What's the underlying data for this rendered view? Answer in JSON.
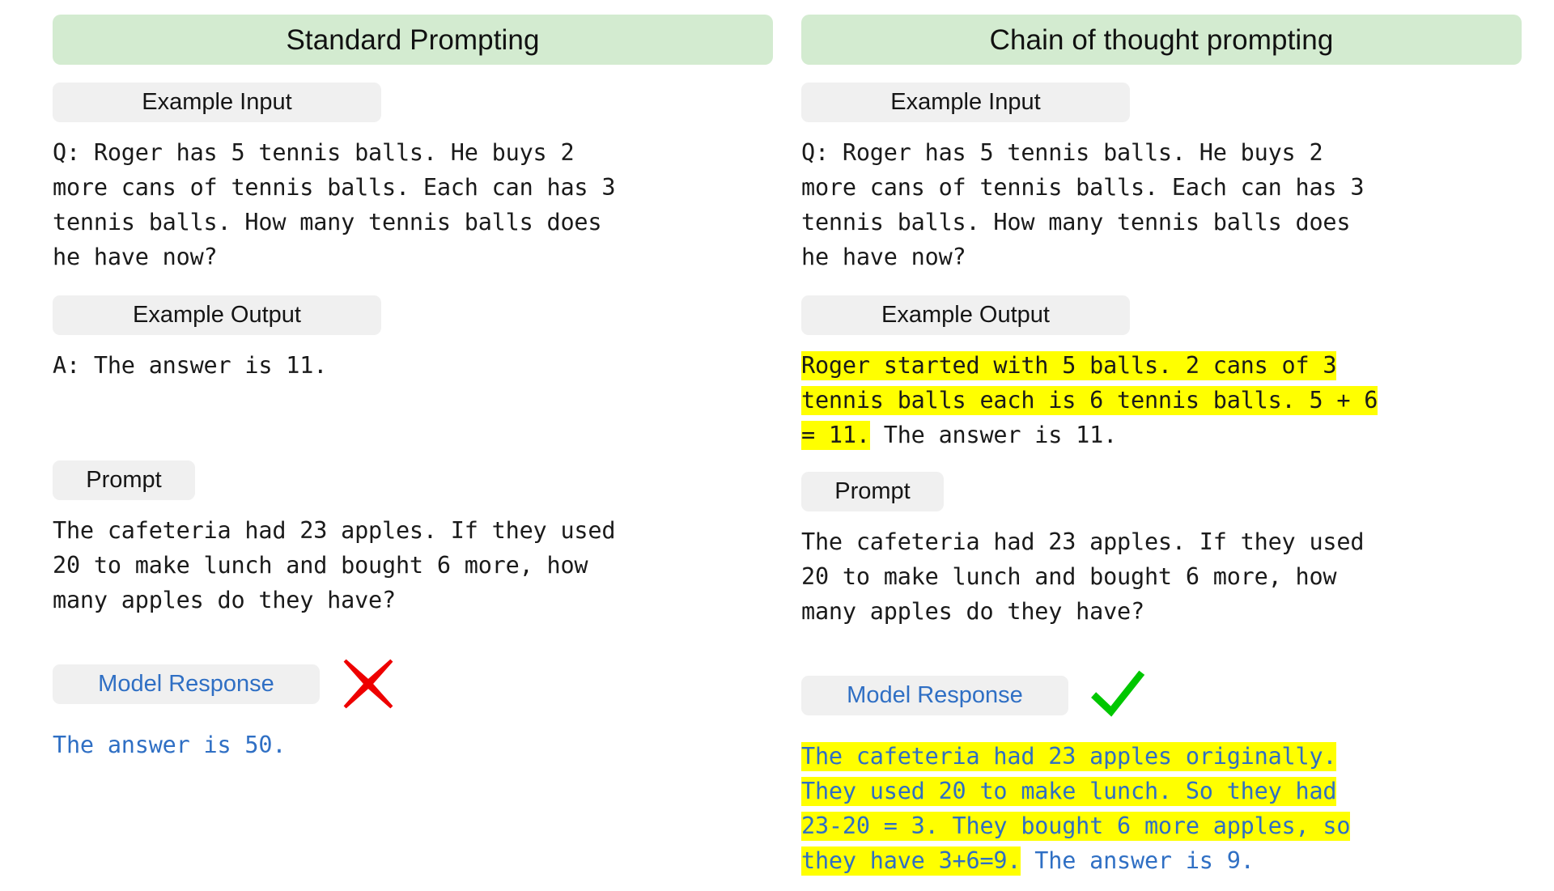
{
  "colors": {
    "header_bg": "#d3ebd0",
    "chip_bg": "#f0f0f0",
    "highlight": "#ffff00",
    "response_blue": "#2f6fc4",
    "cross_red": "#ee0000",
    "check_green": "#00c700",
    "body_text": "#1a1a1a"
  },
  "columns": [
    {
      "title": "Standard Prompting",
      "labels": {
        "example_input": "Example Input",
        "example_output": "Example Output",
        "prompt": "Prompt",
        "model_response": "Model Response"
      },
      "example_input": "Q: Roger has 5 tennis balls. He buys 2\nmore cans of tennis balls. Each can has 3\ntennis balls. How many tennis balls does\nhe have now?",
      "example_output": {
        "highlighted": "",
        "plain": "A: The answer is 11."
      },
      "prompt": "The cafeteria had 23 apples. If they used\n20 to make lunch and bought 6 more, how\nmany apples do they have?",
      "model_response": {
        "highlighted": "",
        "plain": "The answer is 50."
      },
      "verdict": "cross-icon",
      "verdict_label": "incorrect"
    },
    {
      "title": "Chain of thought prompting",
      "labels": {
        "example_input": "Example Input",
        "example_output": "Example Output",
        "prompt": "Prompt",
        "model_response": "Model Response"
      },
      "example_input": "Q: Roger has 5 tennis balls. He buys 2\nmore cans of tennis balls. Each can has 3\ntennis balls. How many tennis balls does\nhe have now?",
      "example_output": {
        "highlighted": "Roger started with 5 balls. 2 cans of 3\ntennis balls each is 6 tennis balls. 5 + 6\n= 11.",
        "plain": " The answer is 11."
      },
      "prompt": "The cafeteria had 23 apples. If they used\n20 to make lunch and bought 6 more, how\nmany apples do they have?",
      "model_response": {
        "highlighted": "The cafeteria had 23 apples originally.\nThey used 20 to make lunch. So they had\n23-20 = 3. They bought 6 more apples, so\nthey have 3+6=9.",
        "plain": " The answer is 9."
      },
      "verdict": "check-icon",
      "verdict_label": "correct"
    }
  ]
}
